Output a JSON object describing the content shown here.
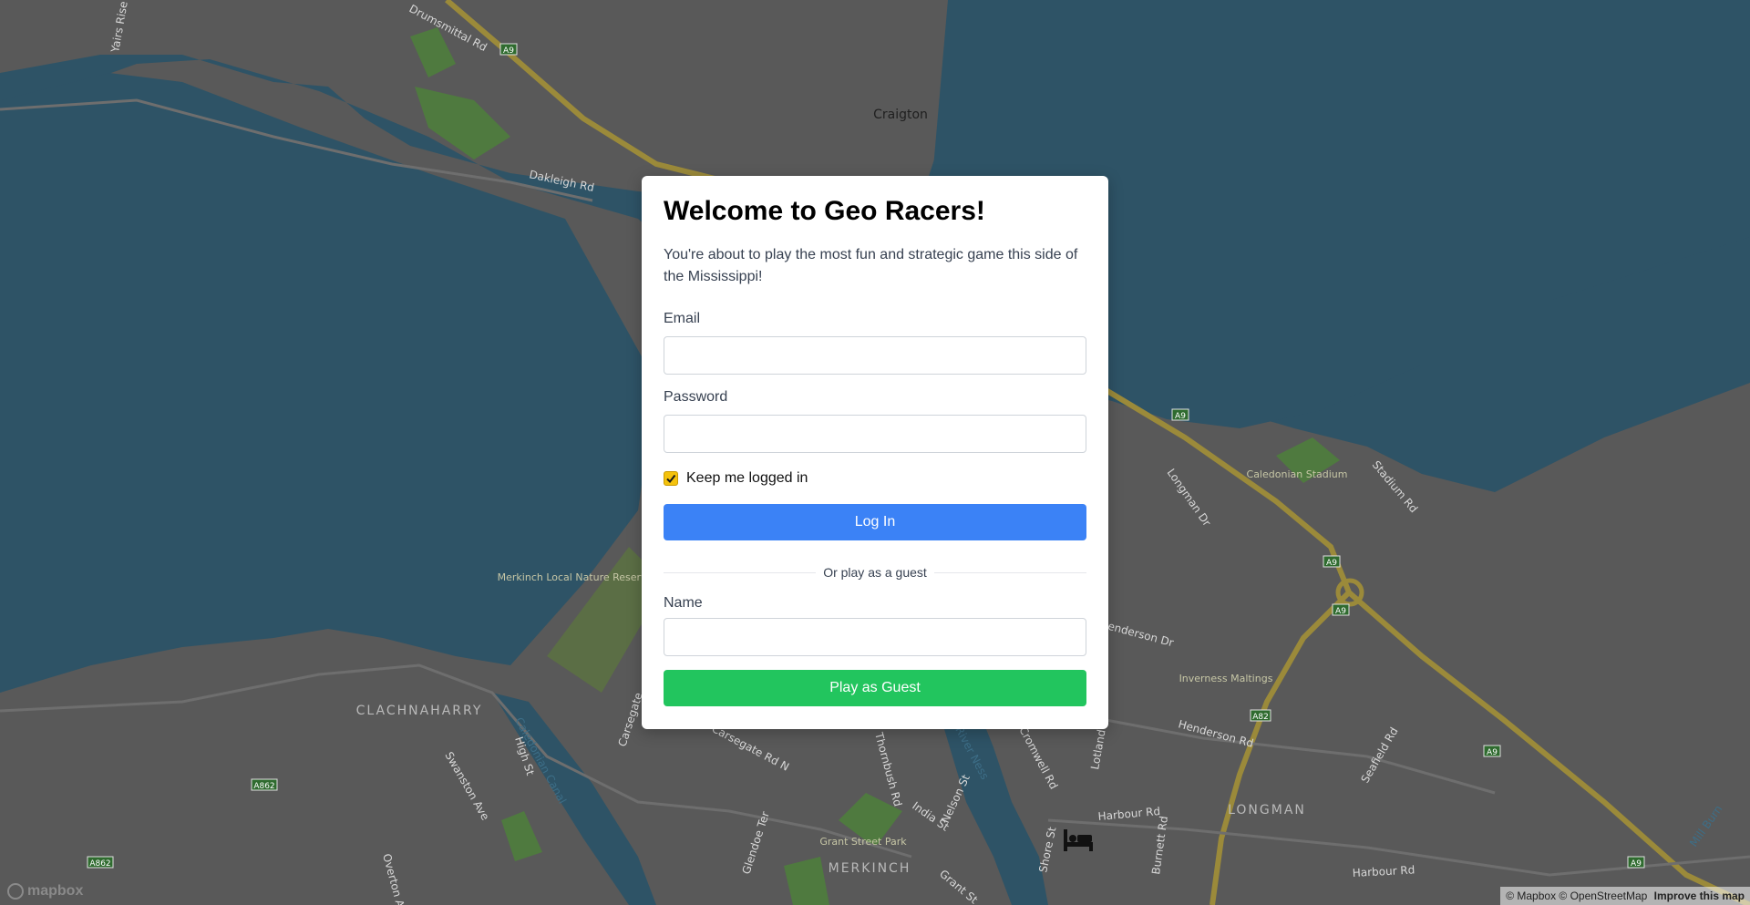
{
  "modal": {
    "title": "Welcome to Geo Racers!",
    "intro": "You're about to play the most fun and strategic game this side of the Mississippi!",
    "email_label": "Email",
    "email_value": "",
    "password_label": "Password",
    "password_value": "",
    "keep_logged_in_label": "Keep me logged in",
    "keep_logged_in_checked": true,
    "login_button": "Log In",
    "divider_text": "Or play as a guest",
    "name_label": "Name",
    "name_value": "",
    "guest_button": "Play as Guest"
  },
  "map": {
    "place_labels": [
      "Craigton",
      "CLACHNAHARRY",
      "LONGMAN",
      "MERKINCH"
    ],
    "street_labels": [
      "Drumsmittal Rd",
      "Yairs Rise",
      "Dakleigh Rd",
      "Longman Dr",
      "Stadium Rd",
      "Henderson Dr",
      "Henderson Rd",
      "Seafield Rd",
      "Harbour Rd",
      "Harbour Rd",
      "High St",
      "Swanston Ave",
      "Overton Ave",
      "Glendoe Ter",
      "Carsegate Rd N",
      "Carsegate",
      "Cromwell Rd",
      "Lotland St",
      "Shore St",
      "Burnett Rd",
      "India St",
      "Nelson St",
      "Grant St",
      "Thornbush Rd"
    ],
    "road_shields": [
      "A9",
      "A9",
      "A9",
      "A9",
      "A9",
      "A9",
      "A82",
      "A862",
      "A862"
    ],
    "water_labels": [
      "Caledonian Canal",
      "River Ness",
      "Mill Burn"
    ],
    "poi_labels": [
      "Merkinch Local Nature Reserve",
      "Caledonian Stadium",
      "Inverness Maltings",
      "Grant Street Park"
    ],
    "hotel_icon": "bed-icon",
    "logo_text": "mapbox",
    "attribution": "© Mapbox © OpenStreetMap",
    "improve_link": "Improve this map"
  },
  "colors": {
    "water": "#2e5366",
    "land": "#595959",
    "road_major": "#9b8a3a",
    "park": "#4f7a3f",
    "login_button": "#3b82f6",
    "guest_button": "#22c55e",
    "checkbox": "#f4c20d"
  }
}
